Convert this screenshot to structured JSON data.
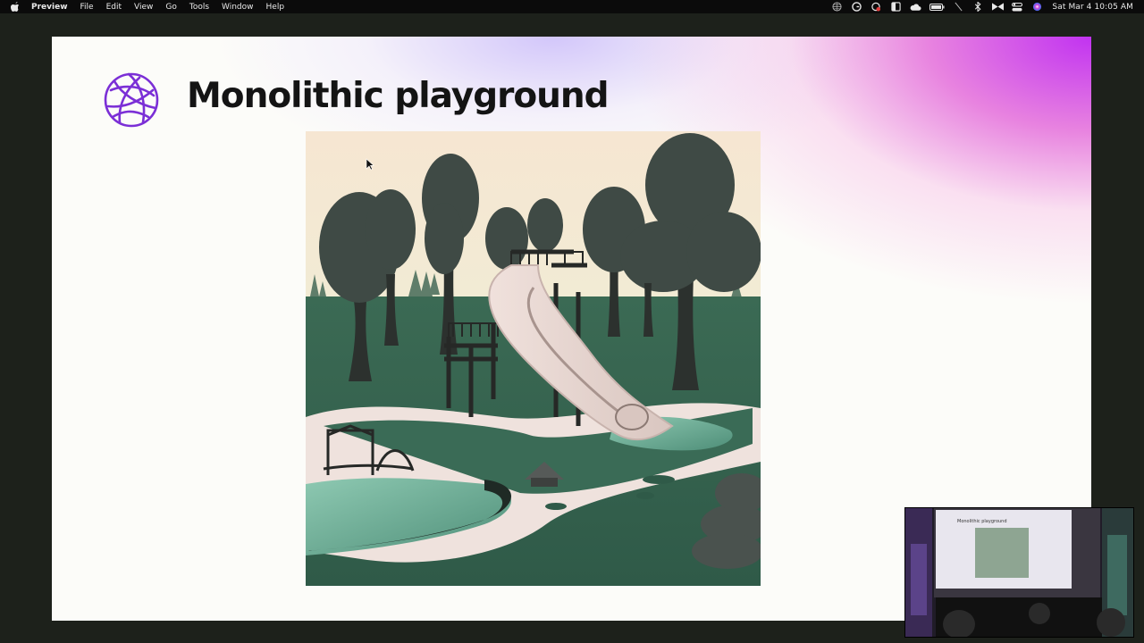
{
  "menubar": {
    "app_name": "Preview",
    "items": [
      "File",
      "Edit",
      "View",
      "Go",
      "Tools",
      "Window",
      "Help"
    ],
    "status_icons": [
      "vpn-globe-icon",
      "grammar-icon",
      "screen-record-icon",
      "sidebar-icon",
      "cloud-icon",
      "battery-icon",
      "slash-icon",
      "bluetooth-icon",
      "bowtie-icon",
      "control-center-icon",
      "siri-icon"
    ],
    "clock": "Sat Mar 4  10:05 AM"
  },
  "slide": {
    "title": "Monolithic playground",
    "accent": "#7b2fd6",
    "gradient_colors": [
      "#b52cf0",
      "#f08ad6",
      "#c9bdf7"
    ],
    "image_icon": "ai-generated-playground-image"
  },
  "webcam": {
    "projected_title": "Monolithic playground",
    "icon": "presenter-webcam-thumbnail"
  }
}
